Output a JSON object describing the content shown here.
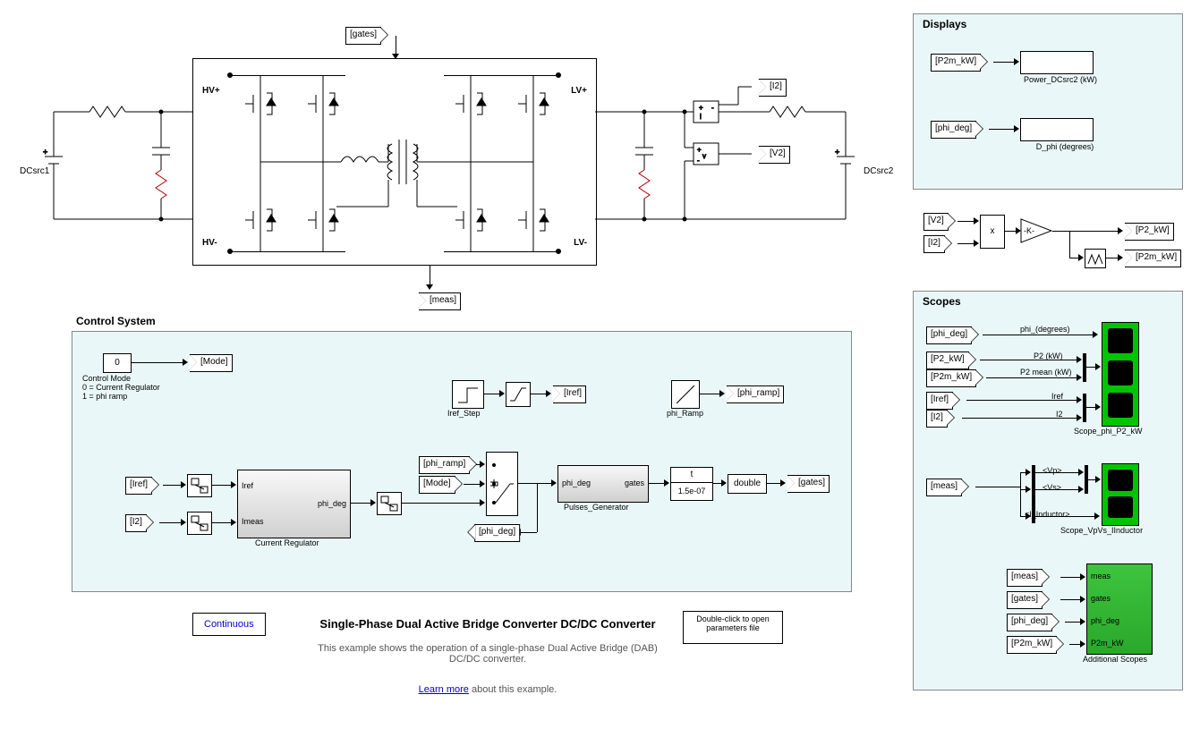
{
  "topTags": {
    "gates": "[gates]",
    "meas": "[meas]"
  },
  "circuit": {
    "dcsrc1": "DCsrc1",
    "dcsrc2": "DCsrc2",
    "hvplus": "HV+",
    "hvminus": "HV-",
    "lvplus": "LV+",
    "lvminus": "LV-",
    "i2_tag": "[I2]",
    "v2_tag": "[V2]",
    "measure_i": "i",
    "measure_v": "v"
  },
  "control": {
    "title": "Control System",
    "mode_val": "0",
    "mode_label": "Control Mode\n0 = Current Regulator\n1 = phi ramp",
    "mode_tag": "[Mode]",
    "iref_tag": "[Iref]",
    "i2_tag": "[I2]",
    "phi_ramp_tag": "[phi_ramp]",
    "phi_deg_tag": "[phi_deg]",
    "gates_tag": "[gates]",
    "iref_step_label": "Iref_Step",
    "phi_ramp_label": "phi_Ramp",
    "cur_reg_label": "Current Regulator",
    "cur_reg_in1": "Iref",
    "cur_reg_in2": "Imeas",
    "cur_reg_out": "phi_deg",
    "pulses_label": "Pulses_Generator",
    "pulses_in": "phi_deg",
    "pulses_out": "gates",
    "ts_top": "t",
    "ts_bot": "1.5e-07",
    "double": "double"
  },
  "displays": {
    "title": "Displays",
    "p2m_tag": "[P2m_kW]",
    "p2m_label": "Power_DCsrc2 (kW)",
    "phi_tag": "[phi_deg]",
    "phi_label": "D_phi (degrees)"
  },
  "calc": {
    "v2": "[V2]",
    "i2": "[I2]",
    "mul": "x",
    "gain": "-K-",
    "p2kw": "[P2_kW]",
    "p2mkw": "[P2m_kW]"
  },
  "scopes": {
    "title": "Scopes",
    "phi_deg": "[phi_deg]",
    "p2_kw": "[P2_kW]",
    "p2m_kw": "[P2m_kW]",
    "iref": "[Iref]",
    "i2": "[I2]",
    "sig_phi": "phi_(degrees)",
    "sig_p2": "P2 (kW)",
    "sig_p2m": "P2 mean (kW)",
    "sig_iref": "Iref",
    "sig_i2": "I2",
    "scope1_label": "Scope_phi_P2_kW",
    "meas": "[meas]",
    "vp": "<Vp>",
    "vs": "<Vs>",
    "il": "<I_Inductor>",
    "scope2_label": "Scope_VpVs_IInductor",
    "gates": "[gates]",
    "as_meas": "meas",
    "as_gates": "gates",
    "as_phi": "phi_deg",
    "as_p2m": "P2m_kW",
    "scope3_label": "Additional Scopes"
  },
  "footer": {
    "powergui": "Continuous",
    "title": "Single-Phase Dual Active Bridge Converter DC/DC Converter",
    "desc1": "This example shows the operation of a single-phase Dual Active Bridge (DAB) DC/DC converter.",
    "learn": "Learn more",
    "learn_rest": " about this example.",
    "dblclick": "Double-click to open parameters file"
  }
}
